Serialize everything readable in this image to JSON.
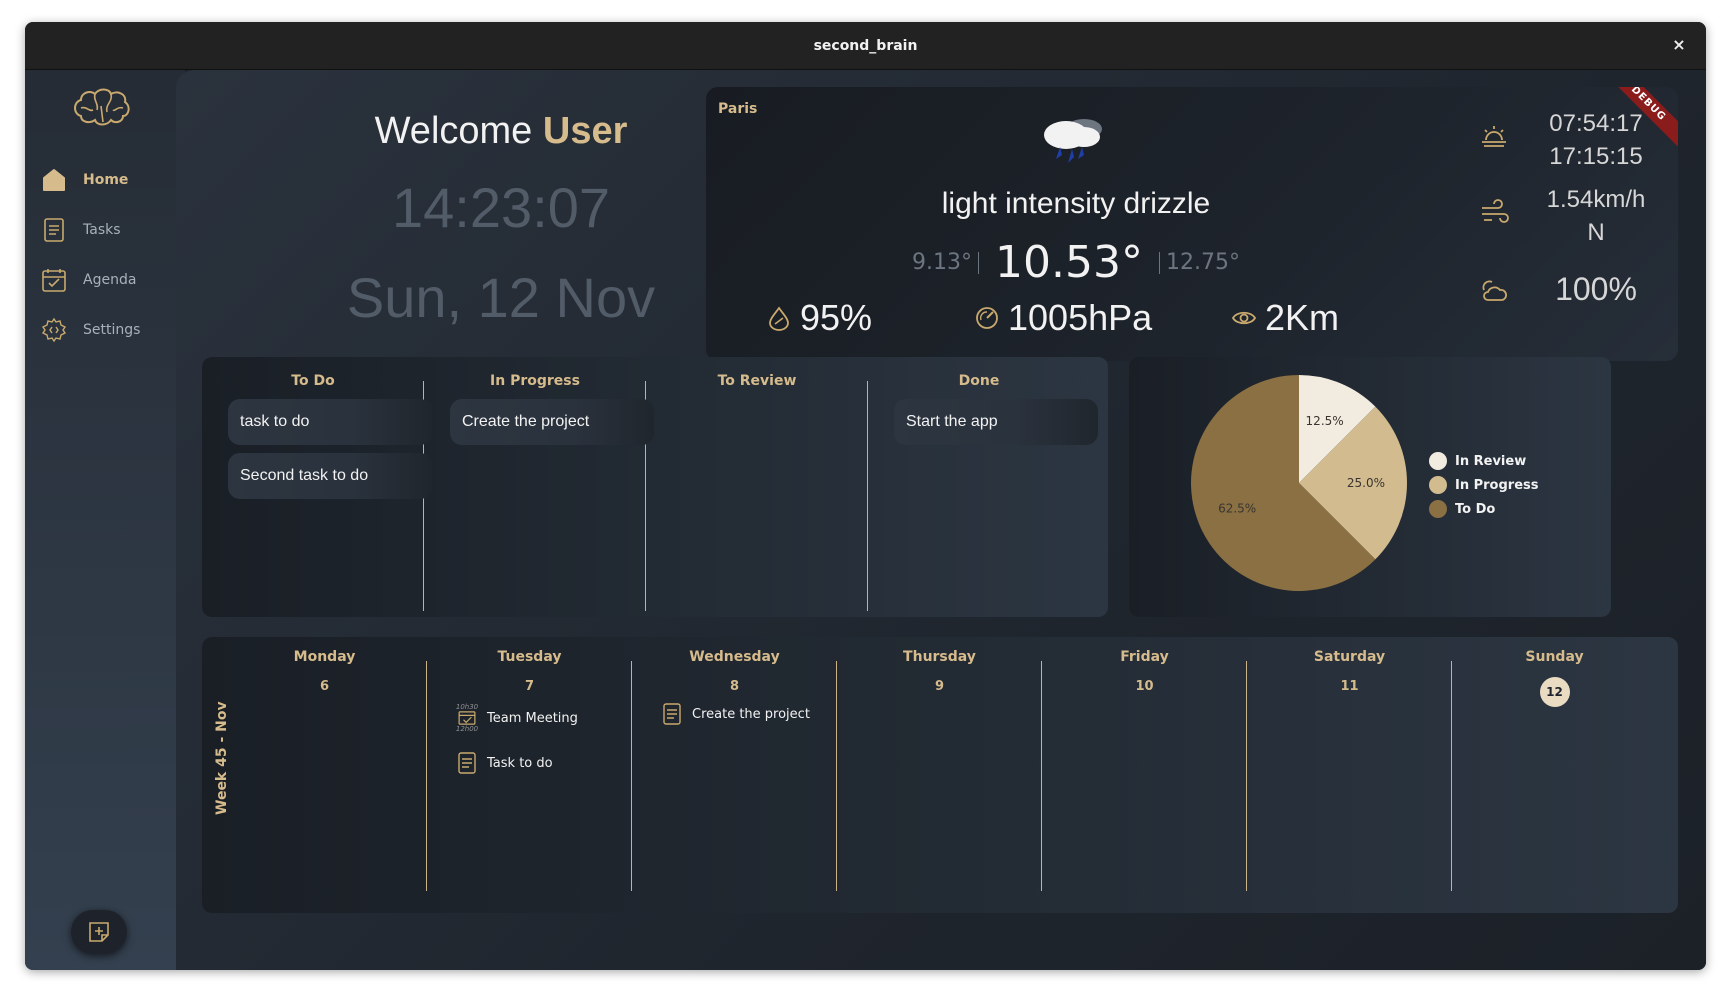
{
  "window": {
    "title": "second_brain",
    "close_glyph": "×"
  },
  "sidebar": {
    "logo_icon": "brain-icon",
    "items": [
      {
        "label": "Home",
        "icon": "home-icon",
        "active": true
      },
      {
        "label": "Tasks",
        "icon": "tasks-icon",
        "active": false
      },
      {
        "label": "Agenda",
        "icon": "agenda-icon",
        "active": false
      },
      {
        "label": "Settings",
        "icon": "settings-icon",
        "active": false
      }
    ],
    "add_icon": "add-note-icon"
  },
  "welcome": {
    "prefix": "Welcome ",
    "user": "User",
    "time": "14:23:07",
    "date": "Sun, 12 Nov"
  },
  "weather": {
    "city": "Paris",
    "description": "light intensity drizzle",
    "temp_min": "9.13°",
    "temp_current": "10.53°",
    "temp_max": "12.75°",
    "humidity": "95%",
    "pressure": "1005hPa",
    "visibility": "2Km",
    "sunrise": "07:54:17",
    "sunset": "17:15:15",
    "wind_speed": "1.54km/h",
    "wind_dir": "N",
    "clouds": "100%",
    "debug_banner": "DEBUG",
    "colors": {
      "accent": "#d6bb8c"
    }
  },
  "kanban": {
    "columns": [
      {
        "title": "To Do",
        "cards": [
          "task to do",
          "Second task to do"
        ]
      },
      {
        "title": "In Progress",
        "cards": [
          "Create the project"
        ]
      },
      {
        "title": "To Review",
        "cards": []
      },
      {
        "title": "Done",
        "cards": [
          "Start the app"
        ]
      }
    ]
  },
  "chart_data": {
    "type": "pie",
    "slices": [
      {
        "name": "In Review",
        "value": 12.5,
        "label": "12.5%",
        "color": "#f2ece0"
      },
      {
        "name": "In Progress",
        "value": 25.0,
        "label": "25.0%",
        "color": "#d2bb8f"
      },
      {
        "name": "To Do",
        "value": 62.5,
        "label": "62.5%",
        "color": "#8a7042"
      }
    ]
  },
  "agenda": {
    "week_label": "Week 45 - Nov",
    "days": [
      {
        "name": "Monday",
        "num": "6"
      },
      {
        "name": "Tuesday",
        "num": "7"
      },
      {
        "name": "Wednesday",
        "num": "8"
      },
      {
        "name": "Thursday",
        "num": "9"
      },
      {
        "name": "Friday",
        "num": "10"
      },
      {
        "name": "Saturday",
        "num": "11"
      },
      {
        "name": "Sunday",
        "num": "12",
        "today": true
      }
    ],
    "events": [
      {
        "day": 1,
        "title": "Team Meeting",
        "start": "10h30",
        "end": "12h00",
        "icon": "calendar-check-icon"
      },
      {
        "day": 1,
        "title": "Task to do",
        "icon": "task-note-icon"
      },
      {
        "day": 2,
        "title": "Create the project",
        "icon": "task-note-icon"
      }
    ]
  }
}
